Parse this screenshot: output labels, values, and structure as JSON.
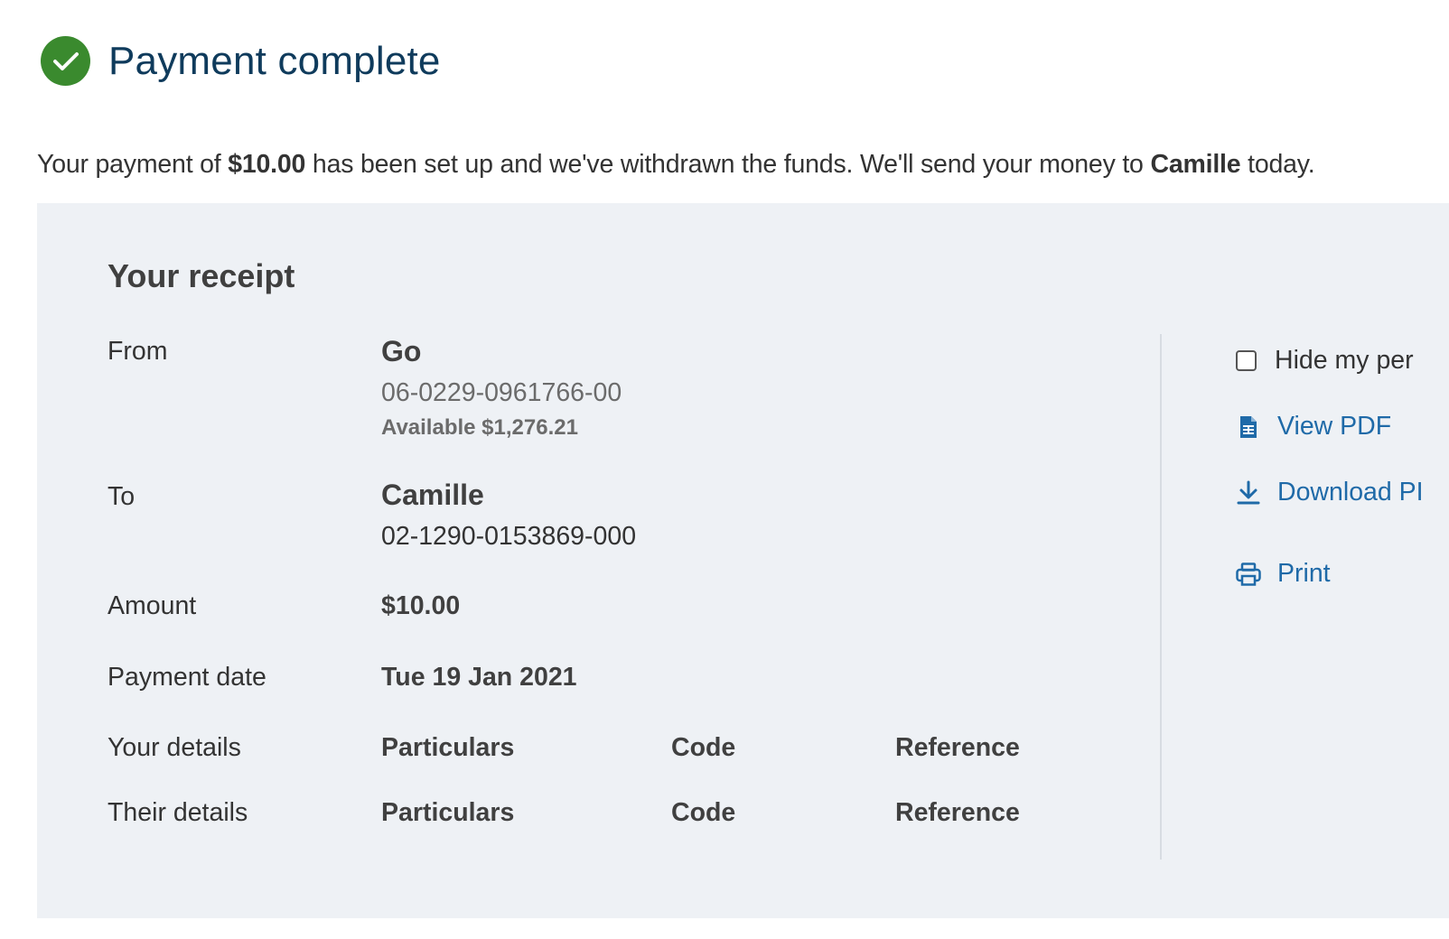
{
  "header": {
    "title": "Payment complete",
    "icon": "check-circle-icon",
    "icon_color": "#3a8a2e"
  },
  "intro": {
    "prefix": "Your payment of ",
    "amount": "$10.00",
    "middle": " has been set up and we've withdrawn the funds. We'll send your money to ",
    "recipient": "Camille",
    "suffix": " today."
  },
  "receipt": {
    "title": "Your receipt",
    "from": {
      "label": "From",
      "name": "Go",
      "account": "06-0229-0961766-00",
      "available": "Available $1,276.21"
    },
    "to": {
      "label": "To",
      "name": "Camille",
      "account": "02-1290-0153869-000"
    },
    "amount": {
      "label": "Amount",
      "value": "$10.00"
    },
    "payment_date": {
      "label": "Payment date",
      "value": "Tue 19 Jan 2021"
    },
    "your_details": {
      "label": "Your details",
      "particulars": "Particulars",
      "code": "Code",
      "reference": "Reference"
    },
    "their_details": {
      "label": "Their details",
      "particulars": "Particulars",
      "code": "Code",
      "reference": "Reference"
    }
  },
  "actions": {
    "hide_label": "Hide my per",
    "view_pdf": "View PDF",
    "download_pdf": "Download PI",
    "print": "Print"
  },
  "colors": {
    "title": "#0f3b5c",
    "link": "#1f6aa8",
    "panel_bg": "#eef1f5"
  }
}
